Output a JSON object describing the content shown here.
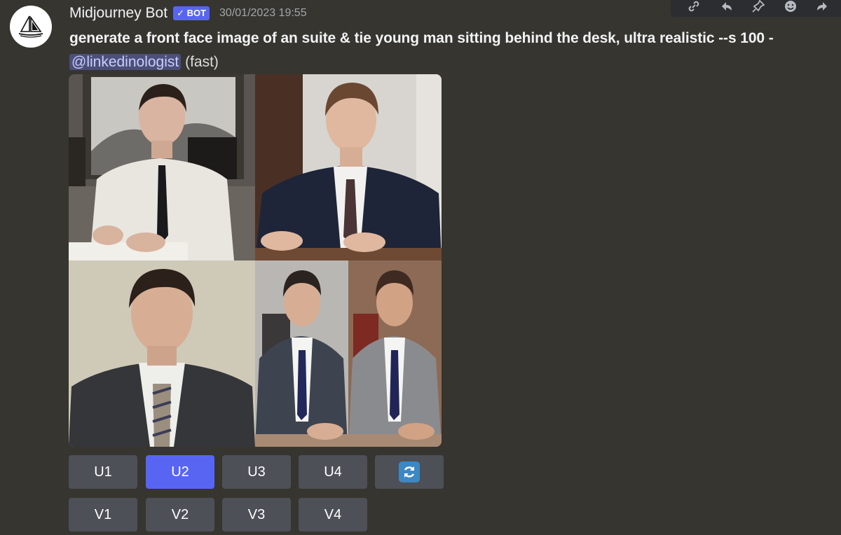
{
  "message": {
    "author": "Midjourney Bot",
    "badge": "✓ BOT",
    "timestamp": "30/01/2023 19:55",
    "prompt": "generate a front face image of an suite & tie young man sitting behind the desk, ultra realistic --s 100 -",
    "mention": "@linkedinologist",
    "mode": "(fast)"
  },
  "toolbar_icons": [
    "link-icon",
    "reply-icon",
    "pin-icon",
    "emoji-icon",
    "forward-icon"
  ],
  "images": [
    {
      "name": "generated-image-1",
      "description_icon": "portrait-image-icon"
    },
    {
      "name": "generated-image-2",
      "description_icon": "portrait-image-icon"
    },
    {
      "name": "generated-image-3",
      "description_icon": "portrait-image-icon"
    },
    {
      "name": "generated-image-4",
      "description_icon": "portrait-image-icon"
    }
  ],
  "buttons": {
    "upscale": [
      "U1",
      "U2",
      "U3",
      "U4"
    ],
    "variation": [
      "V1",
      "V2",
      "V3",
      "V4"
    ],
    "active": "U2",
    "reroll_icon": "refresh-icon"
  },
  "colors": {
    "background": "#36352f",
    "button": "#4e5058",
    "button_active": "#5865f2",
    "mention_bg": "#4b4f7a"
  }
}
